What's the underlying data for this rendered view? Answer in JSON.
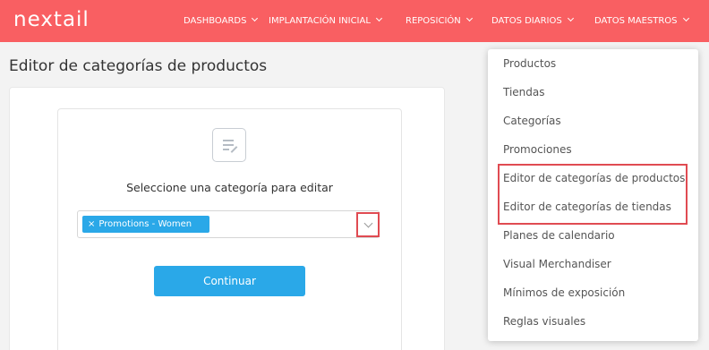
{
  "brand": {
    "logo_text": "nextail",
    "accent_color": "#f95f62",
    "primary_color": "#2aa8e8",
    "highlight_color": "#e04b52"
  },
  "nav": {
    "items": [
      {
        "label": "DASHBOARDS"
      },
      {
        "label": "IMPLANTACIÓN INICIAL"
      },
      {
        "label": "REPOSICIÓN"
      },
      {
        "label": "DATOS DIARIOS"
      },
      {
        "label": "DATOS MAESTROS"
      }
    ]
  },
  "page": {
    "title": "Editor de categorías de productos"
  },
  "editor": {
    "icon": "document-edit-icon",
    "prompt": "Seleccione una categoría para editar",
    "selected_tag": {
      "remove_symbol": "×",
      "label": "Promotions - Women"
    },
    "continue_label": "Continuar"
  },
  "menu": {
    "items": [
      {
        "label": "Productos"
      },
      {
        "label": "Tiendas"
      },
      {
        "label": "Categorías"
      },
      {
        "label": "Promociones"
      },
      {
        "label": "Editor de categorías de productos"
      },
      {
        "label": "Editor de categorías de tiendas"
      },
      {
        "label": "Planes de calendario"
      },
      {
        "label": "Visual Merchandiser"
      },
      {
        "label": "Mínimos de exposición"
      },
      {
        "label": "Reglas visuales"
      }
    ]
  }
}
